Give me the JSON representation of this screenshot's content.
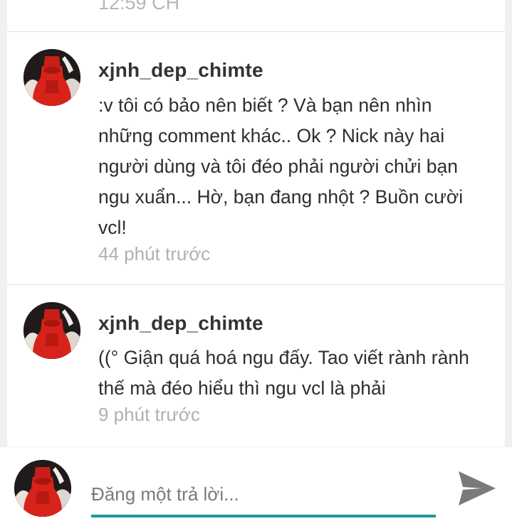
{
  "previous_comment": {
    "time": "12:59 CH"
  },
  "comments": [
    {
      "username": "xjnh_dep_chimte",
      "text": ":v tôi có bảo nên biết ? Và bạn nên nhìn\nnhững comment khác..  Ok ? Nick này hai\nngười dùng và tôi đéo phải người chửi bạn\nngu xuẩn... Hờ, bạn đang nhột ? Buồn cười\nvcl!",
      "time": "44 phút trước"
    },
    {
      "username": "xjnh_dep_chimte",
      "text": "((° Giận quá hoá ngu đấy. Tao viết rành rành\nthế mà đéo hiểu thì ngu vcl là phải",
      "time": "9 phút trước"
    }
  ],
  "composer": {
    "placeholder": "Đăng một trả lời...",
    "accent_color": "#1b9a95",
    "send_icon": "send-icon"
  }
}
